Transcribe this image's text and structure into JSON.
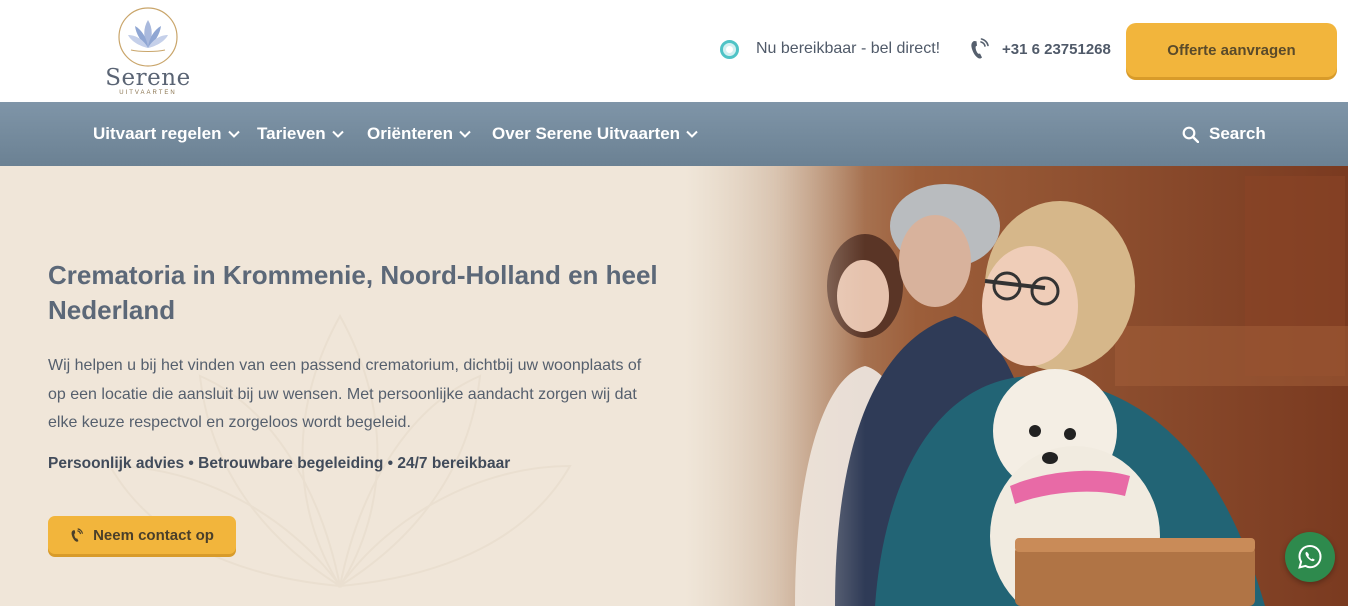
{
  "brand": {
    "name": "Serene",
    "tagline": "UITVAARTEN",
    "logo_icon": "lotus-icon",
    "colors": {
      "accent": "#f2b53c",
      "nav": "#7a8fa2",
      "hero_bg": "#f0e6d9",
      "status": "#4fc3c6",
      "whatsapp": "#2e8a4d"
    }
  },
  "header": {
    "availability": "Nu bereikbaar - bel direct!",
    "phone": "+31 6 23751268",
    "cta_label": "Offerte aanvragen"
  },
  "nav": {
    "items": [
      {
        "label": "Uitvaart regelen"
      },
      {
        "label": "Tarieven"
      },
      {
        "label": "Oriënteren"
      },
      {
        "label": "Over Serene Uitvaarten"
      }
    ],
    "search_label": "Search"
  },
  "hero": {
    "title": "Crematoria in Krommenie, Noord-Holland en heel Nederland",
    "text": "Wij helpen u bij het vinden van een passend crematorium, dichtbij uw woonplaats of op een locatie die aansluit bij uw wensen. Met persoonlijke aandacht zorgen wij dat elke keuze respectvol en zorgeloos wordt begeleid.",
    "usps": "Persoonlijk advies • Betrouwbare begeleiding • 24/7 bereikbaar",
    "cta_label": "Neem contact op"
  }
}
